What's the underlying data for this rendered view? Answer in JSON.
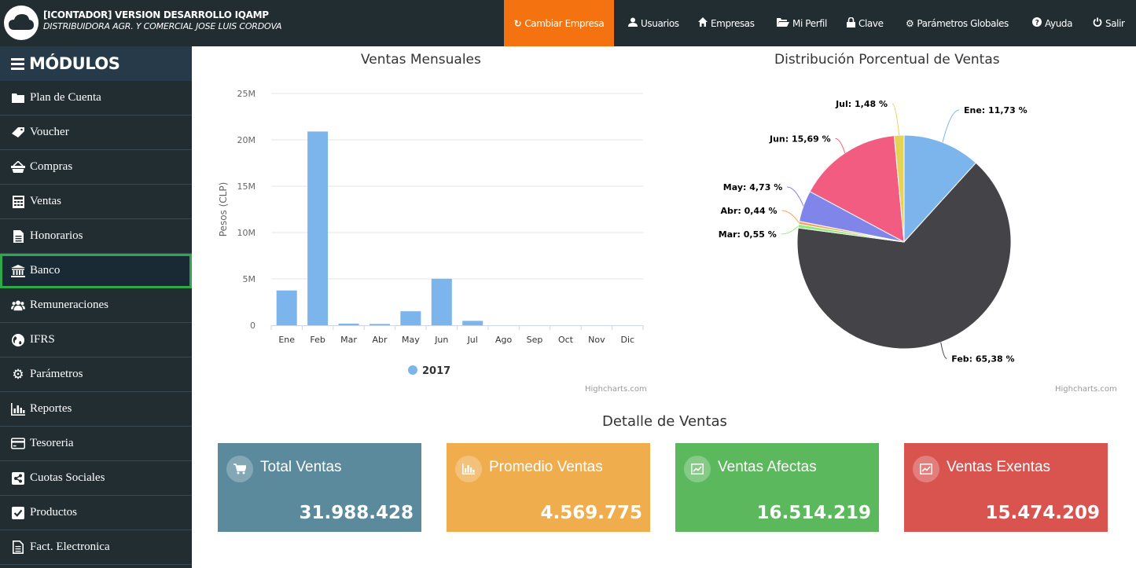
{
  "app": {
    "title": "[ICONTADOR] VERSION DESARROLLO IQAMP",
    "subtitle": "DISTRIBUIDORA AGR. Y COMERCIAL JOSE LUIS CORDOVA"
  },
  "nav": {
    "cambiar_empresa": "Cambiar Empresa",
    "usuarios": "Usuarios",
    "empresas": "Empresas",
    "mi_perfil": "Mi Perfil",
    "clave": "Clave",
    "parametros_globales": "Parámetros Globales",
    "ayuda": "Ayuda",
    "salir": "Salir"
  },
  "sidebar": {
    "header": "MÓDULOS",
    "items": [
      {
        "label": "Plan de Cuenta",
        "icon": "folder-icon"
      },
      {
        "label": "Voucher",
        "icon": "tag-icon"
      },
      {
        "label": "Compras",
        "icon": "basket-icon"
      },
      {
        "label": "Ventas",
        "icon": "calculator-icon"
      },
      {
        "label": "Honorarios",
        "icon": "document-icon"
      },
      {
        "label": "Banco",
        "icon": "bank-icon",
        "active": true
      },
      {
        "label": "Remuneraciones",
        "icon": "users-icon"
      },
      {
        "label": "IFRS",
        "icon": "globe-icon"
      },
      {
        "label": "Parámetros",
        "icon": "gear-icon"
      },
      {
        "label": "Reportes",
        "icon": "bar-chart-icon"
      },
      {
        "label": "Tesoreria",
        "icon": "credit-card-icon"
      },
      {
        "label": "Cuotas Sociales",
        "icon": "share-icon"
      },
      {
        "label": "Productos",
        "icon": "checkbox-icon"
      },
      {
        "label": "Fact. Electronica",
        "icon": "file-text-icon"
      }
    ]
  },
  "bar_chart": {
    "title": "Ventas Mensuales",
    "credits": "Highcharts.com"
  },
  "pie_chart": {
    "title": "Distribución Porcentual de Ventas",
    "credits": "Highcharts.com"
  },
  "chart_data": [
    {
      "type": "bar",
      "title": "Ventas Mensuales",
      "xlabel": "",
      "ylabel": "Pesos (CLP)",
      "categories": [
        "Ene",
        "Feb",
        "Mar",
        "Abr",
        "May",
        "Jun",
        "Jul",
        "Ago",
        "Sep",
        "Oct",
        "Nov",
        "Dic"
      ],
      "series": [
        {
          "name": "2017",
          "values": [
            3750000,
            20900000,
            175000,
            140000,
            1510000,
            5020000,
            475000,
            0,
            0,
            0,
            0,
            0
          ],
          "color": "#7cb5ec"
        }
      ],
      "ylim": [
        0,
        25000000
      ],
      "yticks": [
        "0",
        "5M",
        "10M",
        "15M",
        "20M",
        "25M"
      ],
      "grid": true,
      "legend": "bottom"
    },
    {
      "type": "pie",
      "title": "Distribución Porcentual de Ventas",
      "slices": [
        {
          "label": "Ene",
          "text": "Ene: 11,73 %",
          "value": 11.73,
          "color": "#7cb5ec"
        },
        {
          "label": "Feb",
          "text": "Feb: 65,38 %",
          "value": 65.38,
          "color": "#434348"
        },
        {
          "label": "Mar",
          "text": "Mar: 0,55 %",
          "value": 0.55,
          "color": "#90ed7d"
        },
        {
          "label": "Abr",
          "text": "Abr: 0,44 %",
          "value": 0.44,
          "color": "#f7a35c"
        },
        {
          "label": "May",
          "text": "May: 4,73 %",
          "value": 4.73,
          "color": "#8085e9"
        },
        {
          "label": "Jun",
          "text": "Jun: 15,69 %",
          "value": 15.69,
          "color": "#f15c80"
        },
        {
          "label": "Jul",
          "text": "Jul: 1,48 %",
          "value": 1.48,
          "color": "#e4d354"
        }
      ]
    }
  ],
  "detail": {
    "title": "Detalle de Ventas",
    "cards": [
      {
        "label": "Total Ventas",
        "value": "31.988.428",
        "color": "#5a8a9c",
        "icon": "cart-icon"
      },
      {
        "label": "Promedio Ventas",
        "value": "4.569.775",
        "color": "#f0ad4e",
        "icon": "bar-chart-icon"
      },
      {
        "label": "Ventas Afectas",
        "value": "16.514.219",
        "color": "#5cb85c",
        "icon": "trend-up-icon"
      },
      {
        "label": "Ventas Exentas",
        "value": "15.474.209",
        "color": "#d9534f",
        "icon": "trend-up-icon"
      }
    ]
  }
}
